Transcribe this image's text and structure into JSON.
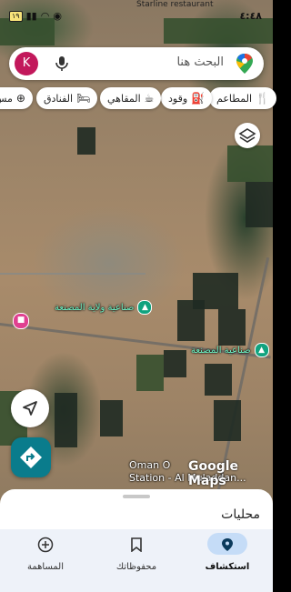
{
  "status_bar": {
    "time": "٤:٤٨",
    "battery": "١٩",
    "place_hint": "Starline restaurant"
  },
  "search": {
    "placeholder": "البحث هنا",
    "avatar_letter": "K"
  },
  "chips": [
    {
      "label": "المطاعم",
      "icon": "restaurant-icon"
    },
    {
      "label": "وقود",
      "icon": "gas-station-icon"
    },
    {
      "label": "المقاهي",
      "icon": "cafe-icon"
    },
    {
      "label": "الفنادق",
      "icon": "hotel-icon"
    },
    {
      "label": "مس",
      "icon": "add-icon"
    }
  ],
  "map": {
    "poi_1": "صناعية ولاية المصنعة",
    "poi_2": "صناعية المصنعة",
    "station": "Oman O",
    "station_line2": "Station - Al Muladdan...",
    "watermark": "Google Maps"
  },
  "sheet": {
    "title": "محليات"
  },
  "nav": {
    "explore": "استكشاف",
    "saved": "محفوظاتك",
    "contribute": "المساهمة"
  },
  "colors": {
    "accent": "#0a7c8c",
    "poi_green": "#10a37f",
    "avatar": "#c2185b"
  }
}
